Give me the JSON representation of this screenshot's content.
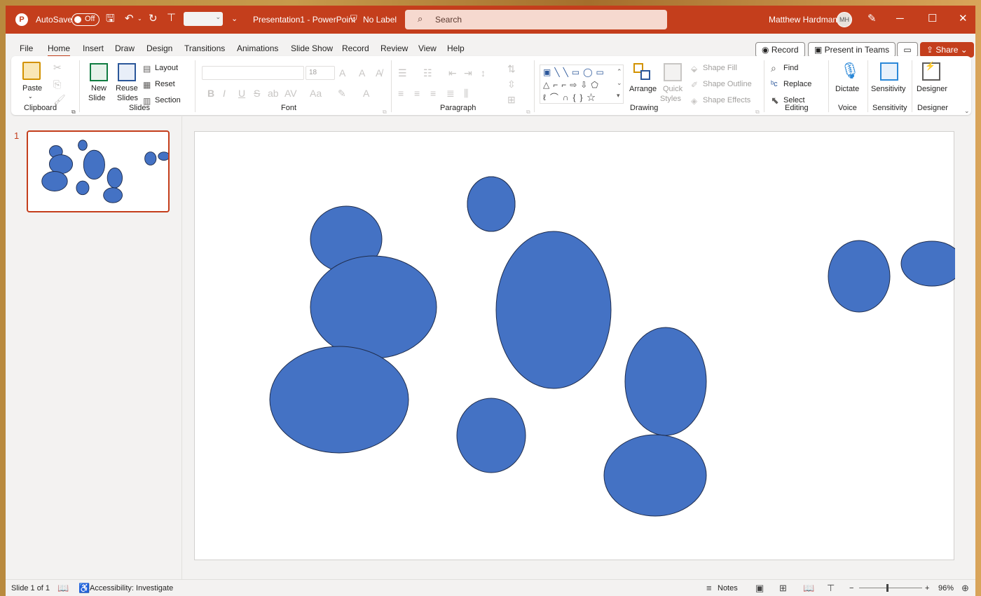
{
  "titlebar": {
    "autosave_label": "AutoSave",
    "autosave_state": "Off",
    "doc_title": "Presentation1  -  PowerPoint",
    "label_status": "No Label",
    "search_placeholder": "Search",
    "user_name": "Matthew Hardman"
  },
  "tabs": [
    "File",
    "Home",
    "Insert",
    "Draw",
    "Design",
    "Transitions",
    "Animations",
    "Slide Show",
    "Record",
    "Review",
    "View",
    "Help"
  ],
  "active_tab": "Home",
  "actions": {
    "record": "Record",
    "present_teams": "Present in Teams",
    "share": "Share"
  },
  "ribbon": {
    "clipboard": {
      "paste": "Paste",
      "group": "Clipboard"
    },
    "slides": {
      "new_slide_1": "New",
      "new_slide_2": "Slide",
      "reuse_1": "Reuse",
      "reuse_2": "Slides",
      "layout": "Layout",
      "reset": "Reset",
      "section": "Section",
      "group": "Slides"
    },
    "font": {
      "size": "18",
      "group": "Font"
    },
    "paragraph": {
      "group": "Paragraph"
    },
    "drawing": {
      "arrange": "Arrange",
      "quick_1": "Quick",
      "quick_2": "Styles",
      "shape_fill": "Shape Fill",
      "shape_outline": "Shape Outline",
      "shape_effects": "Shape Effects",
      "group": "Drawing"
    },
    "editing": {
      "find": "Find",
      "replace": "Replace",
      "select": "Select",
      "group": "Editing"
    },
    "voice": {
      "dictate": "Dictate",
      "group": "Voice"
    },
    "sensitivity": {
      "label": "Sensitivity",
      "group": "Sensitivity"
    },
    "designer": {
      "label": "Designer",
      "group": "Designer"
    }
  },
  "thumbnail": {
    "number": "1"
  },
  "slide": {
    "fill_color": "#4472c4",
    "stroke_color": "#1f2d4d",
    "ellipse_count": 11
  },
  "statusbar": {
    "slide_info": "Slide 1 of 1",
    "accessibility": "Accessibility: Investigate",
    "notes": "Notes",
    "zoom": "96%"
  },
  "colors": {
    "accent": "#c43e1c",
    "shape_fill": "#4472c4"
  }
}
